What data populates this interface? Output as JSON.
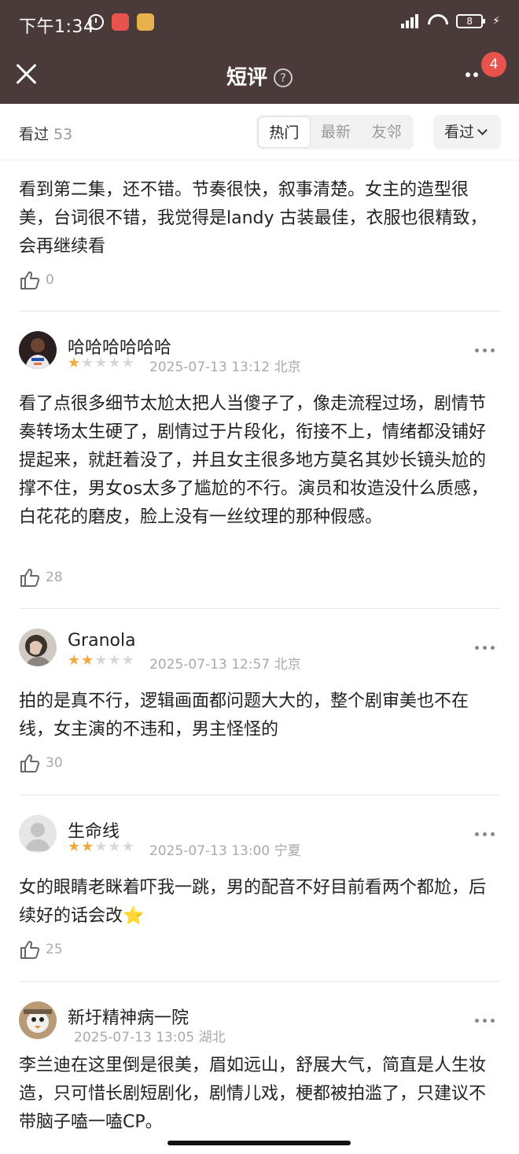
{
  "status_bar": {
    "time": "下午1:34",
    "battery": "8"
  },
  "nav": {
    "title": "短评",
    "help": "?",
    "badge": "4"
  },
  "filter": {
    "seen_label": "看过",
    "seen_count": "53",
    "tabs": [
      "热门",
      "最新",
      "友邻"
    ],
    "active_tab": "热门",
    "dropdown_label": "看过"
  },
  "reviews": [
    {
      "text": "看到第二集，还不错。节奏很快，叙事清楚。女主的造型很美，台词很不错，我觉得是landy 古装最佳，衣服也很精致，会再继续看",
      "likes": "0"
    },
    {
      "username": "哈哈哈哈哈哈",
      "stars": 1,
      "time": "2025-07-13 13:12",
      "location": "北京",
      "text": "看了点很多细节太尬太把人当傻子了，像走流程过场，剧情节奏转场太生硬了，剧情过于片段化，衔接不上，情绪都没铺好提起来，就赶着没了，并且女主很多地方莫名其妙长镜头尬的撑不住，男女os太多了尴尬的不行。演员和妆造没什么质感，白花花的磨皮，脸上没有一丝纹理的那种假感。",
      "likes": "28"
    },
    {
      "username": "Granola",
      "stars": 2,
      "time": "2025-07-13 12:57",
      "location": "北京",
      "text": "拍的是真不行，逻辑画面都问题大大的，整个剧审美也不在线，女主演的不违和，男主怪怪的",
      "likes": "30"
    },
    {
      "username": "生命线",
      "stars": 2,
      "time": "2025-07-13 13:00",
      "location": "宁夏",
      "text": "女的眼睛老眯着吓我一跳，男的配音不好目前看两个都尬，后续好的话会改⭐️",
      "likes": "25"
    },
    {
      "username": "新圩精神病一院",
      "time": "2025-07-13 13:05",
      "location": "湖北",
      "text": "李兰迪在这里倒是很美，眉如远山，舒展大气，简直是人生妆造，只可惜长剧短剧化，剧情儿戏，梗都被拍滥了，只建议不带脑子嗑一嗑CP。"
    }
  ],
  "colors": {
    "header_bg": "#4a3a3a",
    "star": "#f2a93b",
    "badge": "#e8534d"
  }
}
